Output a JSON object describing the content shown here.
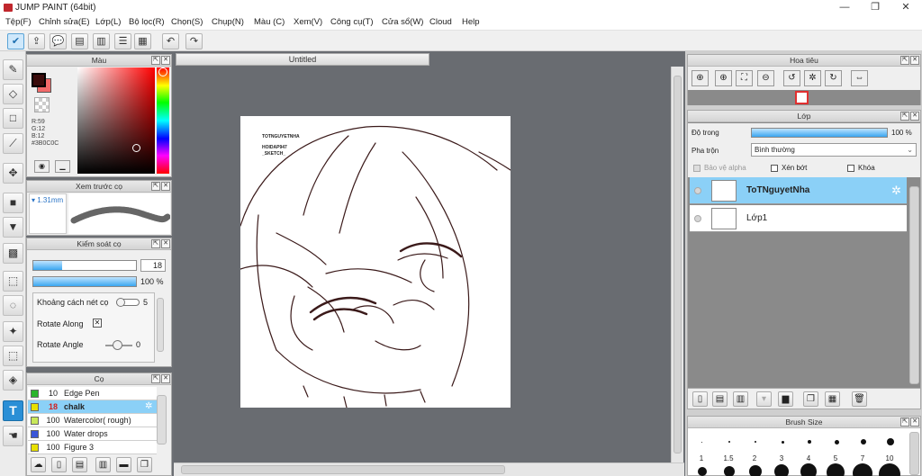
{
  "app": {
    "title": "JUMP PAINT (64bit)",
    "minimize": "—",
    "restore": "❐",
    "close": "✕"
  },
  "menu": [
    "Tệp(F)",
    "Chỉnh sửa(E)",
    "Lớp(L)",
    "Bộ lọc(R)",
    "Chọn(S)",
    "Chụp(N)",
    "Màu (C)",
    "Xem(V)",
    "Công cụ(T)",
    "Cửa sổ(W)",
    "Cloud",
    "Help"
  ],
  "color_panel": {
    "title": "Màu",
    "r": "R:59",
    "g": "G:12",
    "b": "B:12",
    "hex": "#3B0C0C",
    "primary_color": "#3B0C0C",
    "secondary_color": "#f26a6a"
  },
  "preview_panel": {
    "title": "Xem trước cọ",
    "size": "1.31mm"
  },
  "brush_control": {
    "title": "Kiểm soát cọ",
    "size_value": "18",
    "size_level": 0.28,
    "opacity_value": "100 %",
    "opacity_level": 1.0,
    "spacing_label": "Khoảng cách nét cọ",
    "spacing_value": "5",
    "rotate_along_label": "Rotate Along",
    "rotate_angle_label": "Rotate Angle",
    "rotate_angle_value": "0"
  },
  "brush_panel": {
    "title": "Cọ",
    "brushes": [
      {
        "size": "10",
        "name": "Edge Pen",
        "color": "#2bb52b",
        "selected": false
      },
      {
        "size": "18",
        "name": "chalk",
        "color": "#e8e000",
        "selected": true
      },
      {
        "size": "100",
        "name": "Watercolor( rough)",
        "color": "#c8e85a",
        "selected": false
      },
      {
        "size": "100",
        "name": "Water drops",
        "color": "#3a56d8",
        "selected": false
      },
      {
        "size": "100",
        "name": "Figure 3",
        "color": "#e8e000",
        "selected": false
      }
    ]
  },
  "document": {
    "tab_title": "Untitled",
    "sketch_text": [
      "TOTNGUYETNHA",
      "HOIDAP947",
      "_SKETCH_"
    ]
  },
  "navigator": {
    "title": "Hoa tiêu"
  },
  "layers_panel": {
    "title": "Lớp",
    "opacity_label": "Độ trong",
    "opacity_value": "100 %",
    "opacity_level": 1.0,
    "blend_label": "Pha trộn",
    "blend_value": "Bình thường",
    "protect_alpha": "Bảo vệ alpha",
    "clipping": "Xén bớt",
    "lock": "Khóa",
    "layers": [
      {
        "name": "ToTNguyetNha",
        "selected": true
      },
      {
        "name": "Lớp1",
        "selected": false
      }
    ]
  },
  "brush_size_panel": {
    "title": "Brush Size",
    "sizes": [
      "1",
      "1.5",
      "2",
      "3",
      "4",
      "5",
      "7",
      "10"
    ]
  }
}
